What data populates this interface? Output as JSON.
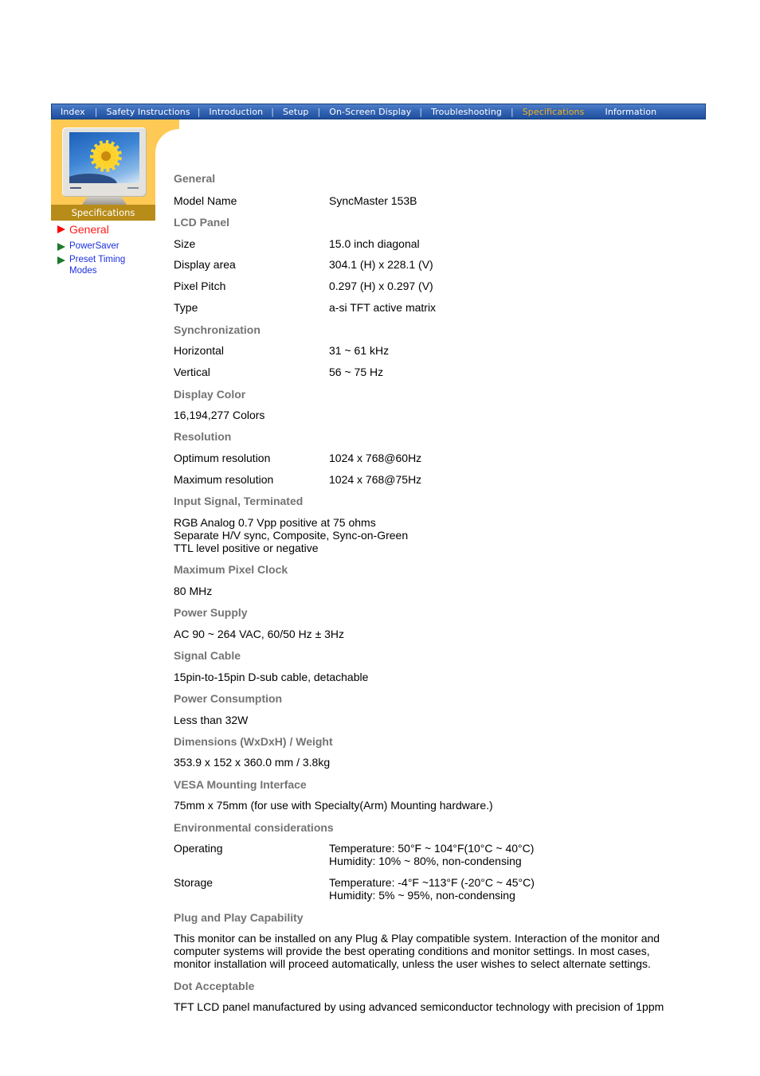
{
  "nav": {
    "items": [
      {
        "label": "Index",
        "active": false
      },
      {
        "label": "Safety Instructions",
        "active": false
      },
      {
        "label": "Introduction",
        "active": false
      },
      {
        "label": "Setup",
        "active": false
      },
      {
        "label": "On-Screen Display",
        "active": false
      },
      {
        "label": "Troubleshooting",
        "active": false
      },
      {
        "label": "Specifications",
        "active": true
      },
      {
        "label": "Information",
        "active": false
      }
    ],
    "separator": "|",
    "colors": {
      "bar": "#3566b5",
      "active": "#f4b31c",
      "text": "#ffffff"
    }
  },
  "header": {
    "section_title": "Specifications",
    "illustration": "monitor-with-flower-image",
    "colors": {
      "background": "#ffc955",
      "banner": "#b88c19"
    }
  },
  "sidebar": {
    "items": [
      {
        "label": "General",
        "current": true,
        "icon": "red-triangle-arrow"
      },
      {
        "label": "PowerSaver",
        "current": false,
        "icon": "green-triangle-arrow"
      },
      {
        "label": "Preset Timing Modes",
        "current": false,
        "icon": "green-triangle-arrow"
      }
    ],
    "colors": {
      "current": "#ff1a1a",
      "link": "#1b2ee0",
      "arrow_current": "#ff0000",
      "arrow_other": "#1f7a2a"
    }
  },
  "specs": {
    "heading_color": "#737373",
    "general": {
      "heading": "General",
      "model_label": "Model Name",
      "model_value": "SyncMaster 153B"
    },
    "lcd_panel": {
      "heading": "LCD Panel",
      "rows": [
        {
          "label": "Size",
          "value": "15.0 inch diagonal"
        },
        {
          "label": "Display area",
          "value": "304.1 (H) x 228.1 (V)"
        },
        {
          "label": "Pixel Pitch",
          "value": "0.297 (H) x 0.297 (V)"
        },
        {
          "label": "Type",
          "value": "a-si TFT active matrix"
        }
      ]
    },
    "synchronization": {
      "heading": "Synchronization",
      "rows": [
        {
          "label": "Horizontal",
          "value": "31 ~ 61 kHz"
        },
        {
          "label": "Vertical",
          "value": "56 ~ 75 Hz"
        }
      ]
    },
    "display_color": {
      "heading": "Display Color",
      "text": "16,194,277 Colors"
    },
    "resolution": {
      "heading": "Resolution",
      "rows": [
        {
          "label": "Optimum resolution",
          "value": "1024 x 768@60Hz"
        },
        {
          "label": "Maximum resolution",
          "value": "1024 x 768@75Hz"
        }
      ]
    },
    "input_signal": {
      "heading": "Input Signal, Terminated",
      "lines": [
        "RGB Analog 0.7 Vpp positive at 75 ohms",
        "Separate H/V sync, Composite, Sync-on-Green",
        "TTL level positive or negative"
      ]
    },
    "max_pixel_clock": {
      "heading": "Maximum Pixel Clock",
      "text": "80 MHz"
    },
    "power_supply": {
      "heading": "Power Supply",
      "text": "AC 90 ~ 264 VAC, 60/50 Hz ± 3Hz"
    },
    "signal_cable": {
      "heading": "Signal Cable",
      "text": "15pin-to-15pin D-sub cable, detachable"
    },
    "power_consumption": {
      "heading": "Power Consumption",
      "text": "Less than 32W"
    },
    "dimensions": {
      "heading": "Dimensions (WxDxH) / Weight",
      "text": "353.9 x 152 x 360.0 mm / 3.8kg"
    },
    "vesa": {
      "heading": "VESA Mounting Interface",
      "text": "75mm x 75mm (for use with Specialty(Arm) Mounting hardware.)"
    },
    "environmental": {
      "heading": "Environmental considerations",
      "rows": [
        {
          "label": "Operating",
          "lines": [
            "Temperature: 50°F ~ 104°F(10°C ~ 40°C)",
            "Humidity: 10% ~ 80%, non-condensing"
          ]
        },
        {
          "label": "Storage",
          "lines": [
            "Temperature: -4°F ~113°F (-20°C ~ 45°C)",
            "Humidity: 5% ~ 95%, non-condensing"
          ]
        }
      ]
    },
    "plug_and_play": {
      "heading": "Plug and Play Capability",
      "lines": [
        "This monitor can be installed on any Plug & Play compatible system. Interaction of the monitor and",
        "computer systems will provide the best operating conditions and monitor settings. In most cases,",
        "monitor installation will proceed automatically, unless the user wishes to select alternate settings."
      ]
    },
    "dot_acceptable": {
      "heading": "Dot Acceptable",
      "text": "TFT LCD panel manufactured by using advanced semiconductor technology with precision of 1ppm"
    }
  }
}
